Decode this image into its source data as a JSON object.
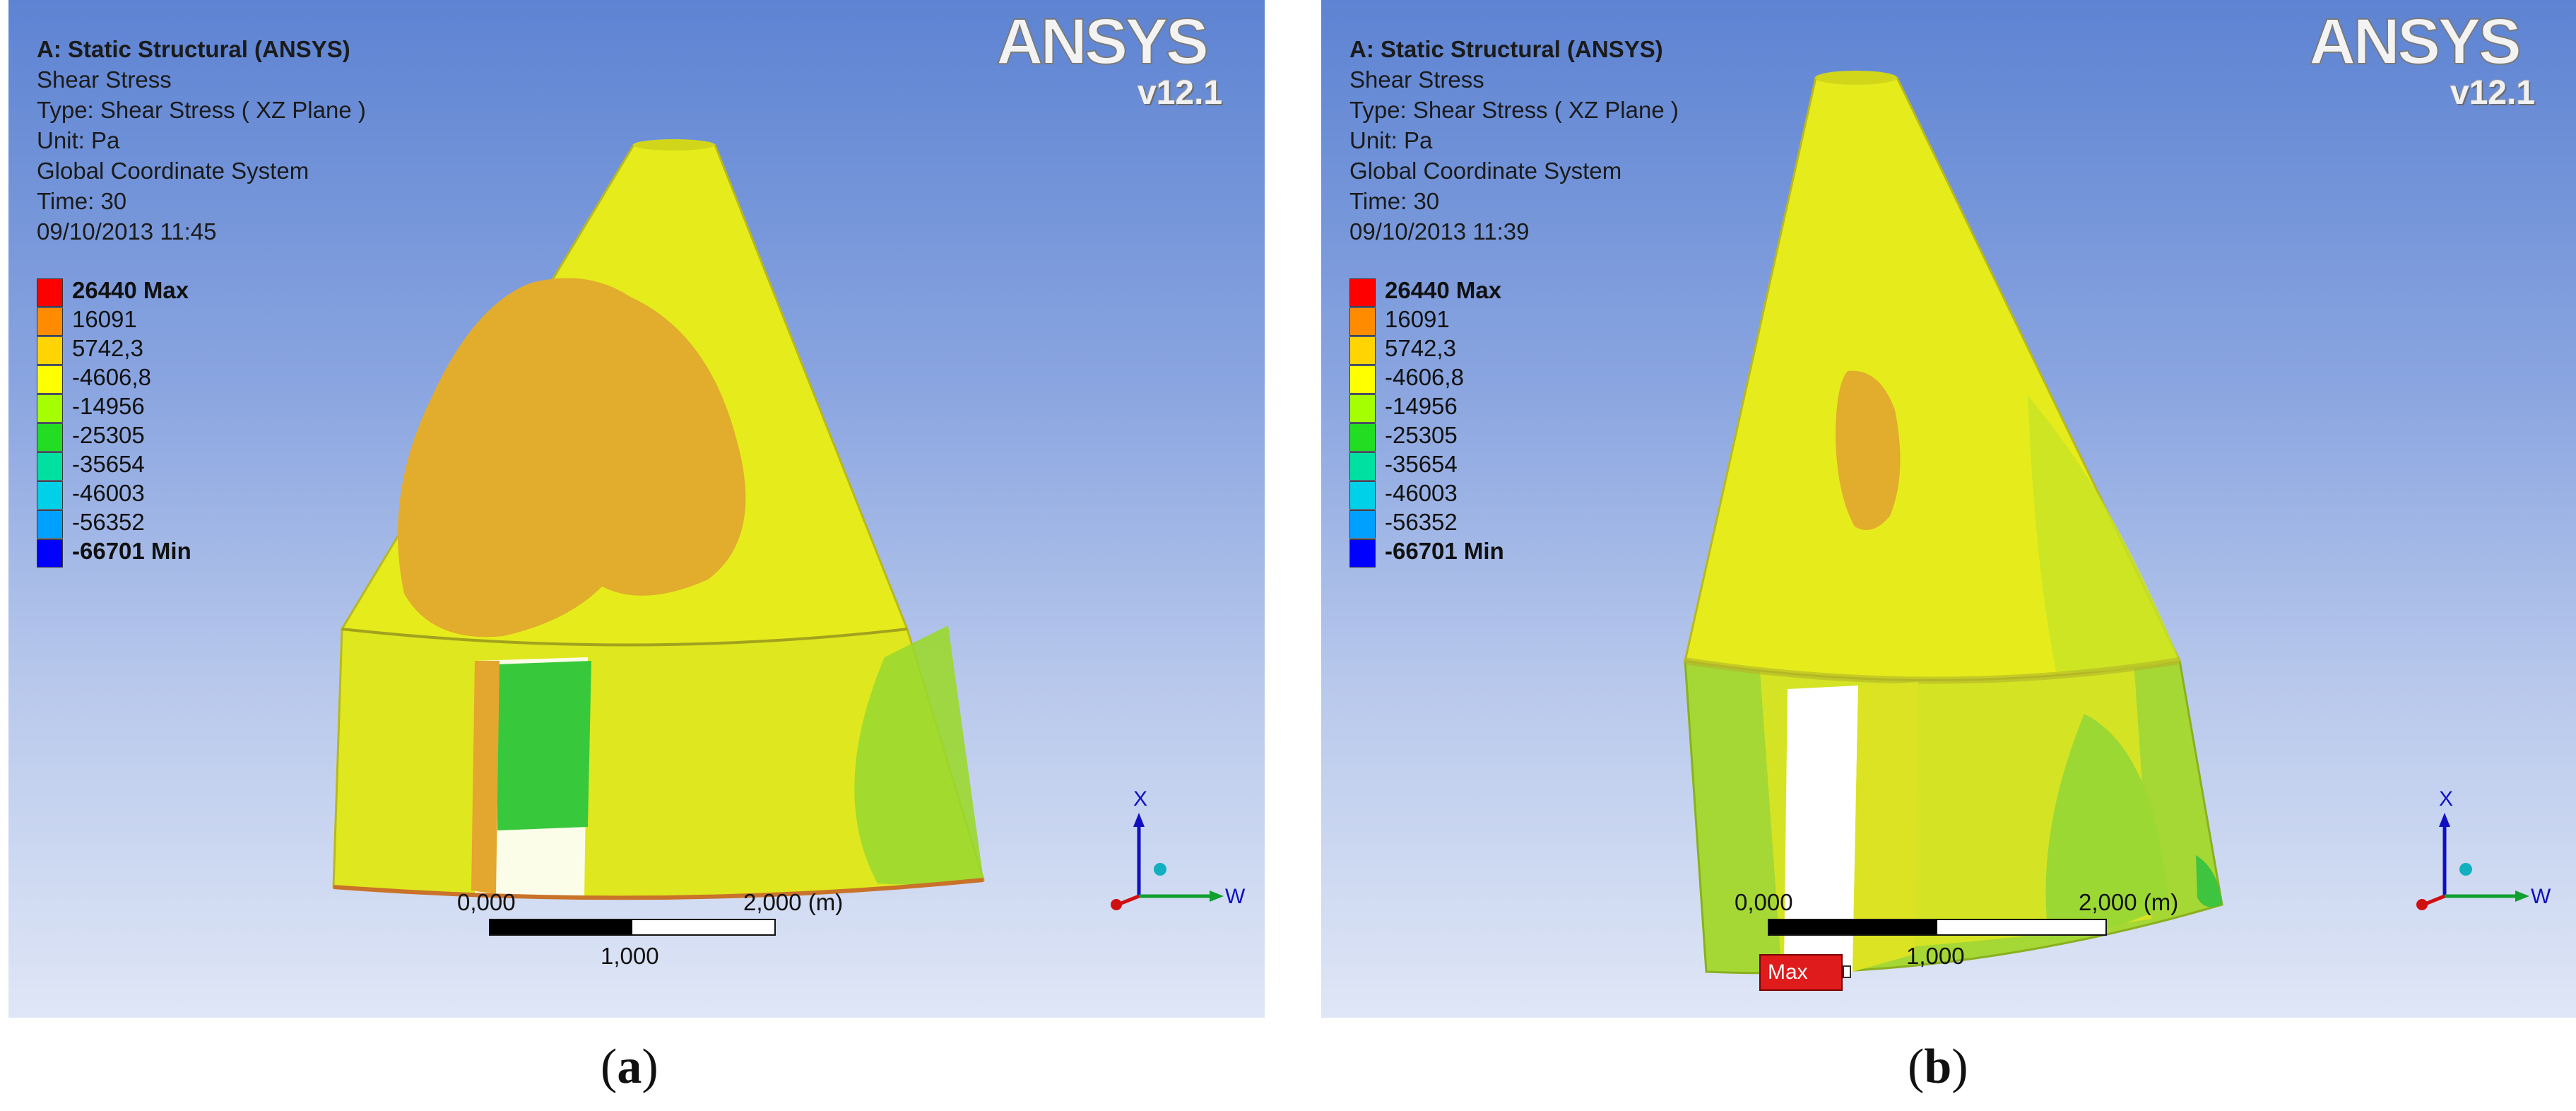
{
  "panels": [
    {
      "title": "A: Static Structural (ANSYS)",
      "result": "Shear Stress",
      "type": "Type: Shear Stress ( XZ Plane )",
      "unit": "Unit: Pa",
      "coords": "Global Coordinate System",
      "time": "Time: 30",
      "date": "09/10/2013 11:45",
      "caption_letter": "a",
      "scale": {
        "start": "0,000",
        "end": "2,000 (m)",
        "mid": "1,000"
      },
      "axis": {
        "x": "X",
        "w": "W"
      }
    },
    {
      "title": "A: Static Structural (ANSYS)",
      "result": "Shear Stress",
      "type": "Type: Shear Stress ( XZ Plane )",
      "unit": "Unit: Pa",
      "coords": "Global Coordinate System",
      "time": "Time: 30",
      "date": "09/10/2013 11:39",
      "caption_letter": "b",
      "scale": {
        "start": "0,000",
        "end": "2,000 (m)",
        "mid": "1,000"
      },
      "axis": {
        "x": "X",
        "w": "W"
      },
      "max_tag": "Max"
    }
  ],
  "legend": [
    {
      "label": "26440 Max",
      "color": "#ff0000"
    },
    {
      "label": "16091",
      "color": "#ff8c00"
    },
    {
      "label": "5742,3",
      "color": "#ffd400"
    },
    {
      "label": "-4606,8",
      "color": "#ffff00"
    },
    {
      "label": "-14956",
      "color": "#a6ff00"
    },
    {
      "label": "-25305",
      "color": "#22dd22"
    },
    {
      "label": "-35654",
      "color": "#00e0a0"
    },
    {
      "label": "-46003",
      "color": "#00d0e8"
    },
    {
      "label": "-56352",
      "color": "#00a0ff"
    },
    {
      "label": "-66701 Min",
      "color": "#0000ff"
    }
  ],
  "brand": {
    "logo": "ANSYS",
    "version": "v12.1"
  },
  "colors": {
    "yellow": "#e6ec1c",
    "orange": "#e2ac2c",
    "green": "#48d04a",
    "light_green": "#9cd834"
  }
}
